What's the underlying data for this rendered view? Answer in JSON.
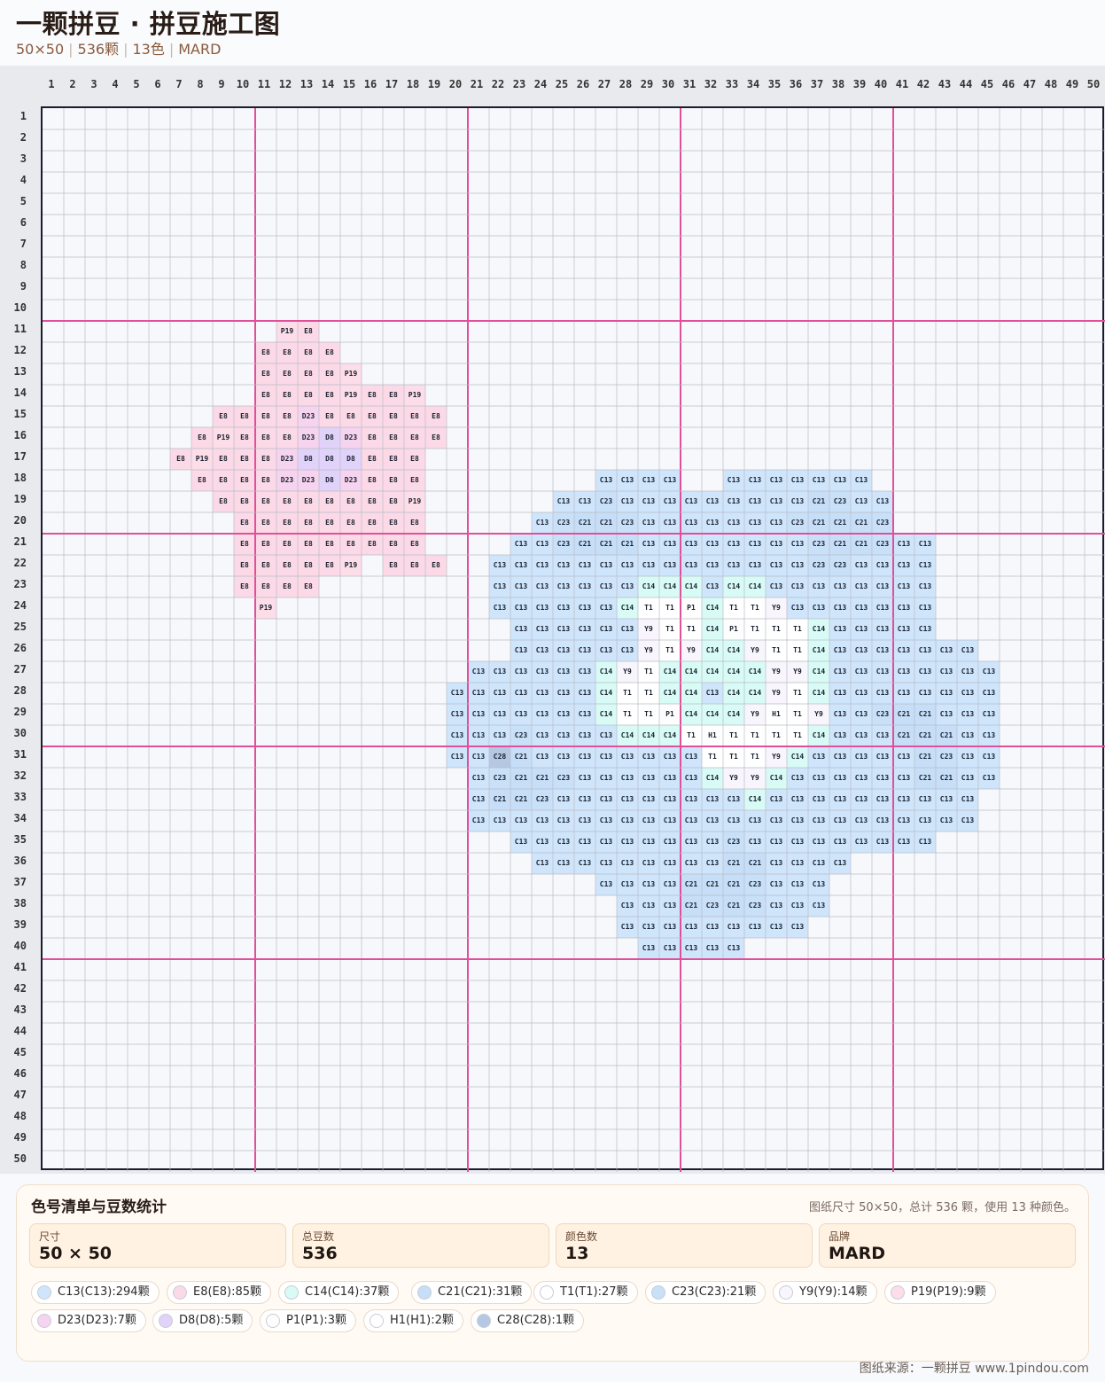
{
  "header": {
    "title": "一颗拼豆 · 拼豆施工图",
    "size": "50×50",
    "count": "536颗",
    "colors": "13色",
    "brand": "MARD"
  },
  "grid": {
    "cols": 50,
    "rows": 50,
    "major_every": 10,
    "palette": {
      "C13": "#cfe5fb",
      "C14": "#d8fbf6",
      "C21": "#c6def7",
      "C23": "#c9e0f9",
      "C28": "#b5c8e3",
      "E8": "#fcd9e6",
      "P19": "#fcdde8",
      "D23": "#f6d3ef",
      "D8": "#e0d2f9",
      "T1": "#ffffff",
      "Y9": "#f8f5fc",
      "P1": "#fdfdfd",
      "H1": "#ffffff"
    },
    "rows_data": [
      {
        "row": 11,
        "start": 12,
        "codes": [
          "P19",
          "E8"
        ]
      },
      {
        "row": 12,
        "start": 11,
        "codes": [
          "E8",
          "E8",
          "E8",
          "E8"
        ]
      },
      {
        "row": 13,
        "start": 11,
        "codes": [
          "E8",
          "E8",
          "E8",
          "E8",
          "P19"
        ]
      },
      {
        "row": 14,
        "start": 11,
        "codes": [
          "E8",
          "E8",
          "E8",
          "E8",
          "P19",
          "E8",
          "E8",
          "P19"
        ]
      },
      {
        "row": 15,
        "start": 9,
        "codes": [
          "E8",
          "E8",
          "E8",
          "E8",
          "D23",
          "E8",
          "E8",
          "E8",
          "E8",
          "E8",
          "E8"
        ]
      },
      {
        "row": 16,
        "start": 8,
        "codes": [
          "E8",
          "P19",
          "E8",
          "E8",
          "E8",
          "D23",
          "D8",
          "D23",
          "E8",
          "E8",
          "E8",
          "E8"
        ]
      },
      {
        "row": 17,
        "start": 7,
        "codes": [
          "E8",
          "P19",
          "E8",
          "E8",
          "E8",
          "D23",
          "D8",
          "D8",
          "D8",
          "E8",
          "E8",
          "E8"
        ]
      },
      {
        "row": 18,
        "start": 8,
        "codes": [
          "E8",
          "E8",
          "E8",
          "E8",
          "D23",
          "D23",
          "D8",
          "D23",
          "E8",
          "E8",
          "E8"
        ]
      },
      {
        "row": 18,
        "start": 27,
        "codes": [
          "C13",
          "C13",
          "C13",
          "C13"
        ]
      },
      {
        "row": 18,
        "start": 33,
        "codes": [
          "C13",
          "C13",
          "C13",
          "C13",
          "C13",
          "C13",
          "C13"
        ]
      },
      {
        "row": 19,
        "start": 9,
        "codes": [
          "E8",
          "E8",
          "E8",
          "E8",
          "E8",
          "E8",
          "E8",
          "E8",
          "E8",
          "P19"
        ]
      },
      {
        "row": 19,
        "start": 25,
        "codes": [
          "C13",
          "C13",
          "C23",
          "C13",
          "C13",
          "C13",
          "C13",
          "C13",
          "C13",
          "C13",
          "C13",
          "C13",
          "C21",
          "C23",
          "C13",
          "C13"
        ]
      },
      {
        "row": 20,
        "start": 10,
        "codes": [
          "E8",
          "E8",
          "E8",
          "E8",
          "E8",
          "E8",
          "E8",
          "E8",
          "E8"
        ]
      },
      {
        "row": 20,
        "start": 24,
        "codes": [
          "C13",
          "C23",
          "C21",
          "C21",
          "C23",
          "C13",
          "C13",
          "C13",
          "C13",
          "C13",
          "C13",
          "C13",
          "C23",
          "C21",
          "C21",
          "C21",
          "C23"
        ]
      },
      {
        "row": 21,
        "start": 10,
        "codes": [
          "E8",
          "E8",
          "E8",
          "E8",
          "E8",
          "E8",
          "E8",
          "E8",
          "E8"
        ]
      },
      {
        "row": 21,
        "start": 23,
        "codes": [
          "C13",
          "C13",
          "C23",
          "C21",
          "C21",
          "C21",
          "C13",
          "C13",
          "C13",
          "C13",
          "C13",
          "C13",
          "C13",
          "C13",
          "C23",
          "C21",
          "C21",
          "C23",
          "C13",
          "C13"
        ]
      },
      {
        "row": 22,
        "start": 10,
        "codes": [
          "E8",
          "E8",
          "E8",
          "E8",
          "E8",
          "P19"
        ]
      },
      {
        "row": 22,
        "start": 17,
        "codes": [
          "E8",
          "E8",
          "E8"
        ]
      },
      {
        "row": 22,
        "start": 22,
        "codes": [
          "C13",
          "C13",
          "C13",
          "C13",
          "C13",
          "C13",
          "C13",
          "C13",
          "C13",
          "C13",
          "C13",
          "C13",
          "C13",
          "C13",
          "C13",
          "C23",
          "C23",
          "C13",
          "C13",
          "C13",
          "C13"
        ]
      },
      {
        "row": 23,
        "start": 10,
        "codes": [
          "E8",
          "E8",
          "E8",
          "E8"
        ]
      },
      {
        "row": 23,
        "start": 22,
        "codes": [
          "C13",
          "C13",
          "C13",
          "C13",
          "C13",
          "C13",
          "C13",
          "C14",
          "C14",
          "C14",
          "C13",
          "C14",
          "C14",
          "C13",
          "C13",
          "C13",
          "C13",
          "C13",
          "C13",
          "C13",
          "C13"
        ]
      },
      {
        "row": 24,
        "start": 11,
        "codes": [
          "P19"
        ]
      },
      {
        "row": 24,
        "start": 22,
        "codes": [
          "C13",
          "C13",
          "C13",
          "C13",
          "C13",
          "C13",
          "C14",
          "T1",
          "T1",
          "P1",
          "C14",
          "T1",
          "T1",
          "Y9",
          "C13",
          "C13",
          "C13",
          "C13",
          "C13",
          "C13",
          "C13"
        ]
      },
      {
        "row": 25,
        "start": 23,
        "codes": [
          "C13",
          "C13",
          "C13",
          "C13",
          "C13",
          "C13",
          "Y9",
          "T1",
          "T1",
          "C14",
          "P1",
          "T1",
          "T1",
          "T1",
          "C14",
          "C13",
          "C13",
          "C13",
          "C13",
          "C13"
        ]
      },
      {
        "row": 26,
        "start": 23,
        "codes": [
          "C13",
          "C13",
          "C13",
          "C13",
          "C13",
          "C13",
          "Y9",
          "T1",
          "Y9",
          "C14",
          "C14",
          "Y9",
          "T1",
          "T1",
          "C14",
          "C13",
          "C13",
          "C13",
          "C13",
          "C13",
          "C13",
          "C13"
        ]
      },
      {
        "row": 27,
        "start": 21,
        "codes": [
          "C13",
          "C13",
          "C13",
          "C13",
          "C13",
          "C13",
          "C14",
          "Y9",
          "T1",
          "C14",
          "C14",
          "C14",
          "C14",
          "C14",
          "Y9",
          "Y9",
          "C14",
          "C13",
          "C13",
          "C13",
          "C13",
          "C13",
          "C13",
          "C13",
          "C13"
        ]
      },
      {
        "row": 28,
        "start": 20,
        "codes": [
          "C13",
          "C13",
          "C13",
          "C13",
          "C13",
          "C13",
          "C13",
          "C14",
          "T1",
          "T1",
          "C14",
          "C14",
          "C13",
          "C14",
          "C14",
          "Y9",
          "T1",
          "C14",
          "C13",
          "C13",
          "C13",
          "C13",
          "C13",
          "C13",
          "C13",
          "C13"
        ]
      },
      {
        "row": 29,
        "start": 20,
        "codes": [
          "C13",
          "C13",
          "C13",
          "C13",
          "C13",
          "C13",
          "C13",
          "C14",
          "T1",
          "T1",
          "P1",
          "C14",
          "C14",
          "C14",
          "Y9",
          "H1",
          "T1",
          "Y9",
          "C13",
          "C13",
          "C23",
          "C21",
          "C21",
          "C13",
          "C13",
          "C13"
        ]
      },
      {
        "row": 30,
        "start": 20,
        "codes": [
          "C13",
          "C13",
          "C13",
          "C23",
          "C13",
          "C13",
          "C13",
          "C13",
          "C14",
          "C14",
          "C14",
          "T1",
          "H1",
          "T1",
          "T1",
          "T1",
          "T1",
          "C14",
          "C13",
          "C13",
          "C13",
          "C21",
          "C21",
          "C21",
          "C13",
          "C13"
        ]
      },
      {
        "row": 31,
        "start": 20,
        "codes": [
          "C13",
          "C13",
          "C28",
          "C21",
          "C13",
          "C13",
          "C13",
          "C13",
          "C13",
          "C13",
          "C13",
          "C13",
          "T1",
          "T1",
          "T1",
          "Y9",
          "C14",
          "C13",
          "C13",
          "C13",
          "C13",
          "C13",
          "C21",
          "C23",
          "C13",
          "C13"
        ]
      },
      {
        "row": 32,
        "start": 21,
        "codes": [
          "C13",
          "C23",
          "C21",
          "C21",
          "C23",
          "C13",
          "C13",
          "C13",
          "C13",
          "C13",
          "C13",
          "C14",
          "Y9",
          "Y9",
          "C14",
          "C13",
          "C13",
          "C13",
          "C13",
          "C13",
          "C13",
          "C21",
          "C21",
          "C13",
          "C13"
        ]
      },
      {
        "row": 33,
        "start": 21,
        "codes": [
          "C13",
          "C21",
          "C21",
          "C23",
          "C13",
          "C13",
          "C13",
          "C13",
          "C13",
          "C13",
          "C13",
          "C13",
          "C13",
          "C14",
          "C13",
          "C13",
          "C13",
          "C13",
          "C13",
          "C13",
          "C13",
          "C13",
          "C13",
          "C13"
        ]
      },
      {
        "row": 34,
        "start": 21,
        "codes": [
          "C13",
          "C13",
          "C13",
          "C13",
          "C13",
          "C13",
          "C13",
          "C13",
          "C13",
          "C13",
          "C13",
          "C13",
          "C13",
          "C13",
          "C13",
          "C13",
          "C13",
          "C13",
          "C13",
          "C13",
          "C13",
          "C13",
          "C13",
          "C13"
        ]
      },
      {
        "row": 35,
        "start": 23,
        "codes": [
          "C13",
          "C13",
          "C13",
          "C13",
          "C13",
          "C13",
          "C13",
          "C13",
          "C13",
          "C13",
          "C23",
          "C13",
          "C13",
          "C13",
          "C13",
          "C13",
          "C13",
          "C13",
          "C13",
          "C13"
        ]
      },
      {
        "row": 36,
        "start": 24,
        "codes": [
          "C13",
          "C13",
          "C13",
          "C13",
          "C13",
          "C13",
          "C13",
          "C13",
          "C13",
          "C21",
          "C21",
          "C13",
          "C13",
          "C13",
          "C13"
        ]
      },
      {
        "row": 37,
        "start": 27,
        "codes": [
          "C13",
          "C13",
          "C13",
          "C13",
          "C21",
          "C21",
          "C21",
          "C23",
          "C13",
          "C13",
          "C13"
        ]
      },
      {
        "row": 38,
        "start": 28,
        "codes": [
          "C13",
          "C13",
          "C13",
          "C21",
          "C23",
          "C21",
          "C23",
          "C13",
          "C13",
          "C13"
        ]
      },
      {
        "row": 39,
        "start": 28,
        "codes": [
          "C13",
          "C13",
          "C13",
          "C13",
          "C13",
          "C13",
          "C13",
          "C13",
          "C13"
        ]
      },
      {
        "row": 40,
        "start": 29,
        "codes": [
          "C13",
          "C13",
          "C13",
          "C13",
          "C13"
        ]
      }
    ]
  },
  "panel": {
    "title": "色号清单与豆数统计",
    "description": "图纸尺寸 50×50，总计 536 颗，使用 13 种颜色。",
    "stats": [
      {
        "label": "尺寸",
        "value": "50 × 50"
      },
      {
        "label": "总豆数",
        "value": "536"
      },
      {
        "label": "颜色数",
        "value": "13"
      },
      {
        "label": "品牌",
        "value": "MARD"
      }
    ],
    "chips": [
      {
        "text": "C13(C13):294颗",
        "color": "#cfe5fb"
      },
      {
        "text": "E8(E8):85颗",
        "color": "#fcd9e6"
      },
      {
        "text": "C14(C14):37颗",
        "color": "#d8fbf6"
      },
      {
        "text": "C21(C21):31颗",
        "color": "#c6def7"
      },
      {
        "text": "T1(T1):27颗",
        "color": "#ffffff"
      },
      {
        "text": "C23(C23):21颗",
        "color": "#c9e0f9"
      },
      {
        "text": "Y9(Y9):14颗",
        "color": "#f8f5fc"
      },
      {
        "text": "P19(P19):9颗",
        "color": "#fcdde8"
      },
      {
        "text": "D23(D23):7颗",
        "color": "#f6d3ef"
      },
      {
        "text": "D8(D8):5颗",
        "color": "#e0d2f9"
      },
      {
        "text": "P1(P1):3颗",
        "color": "#fdfdfd"
      },
      {
        "text": "H1(H1):2颗",
        "color": "#ffffff"
      },
      {
        "text": "C28(C28):1颗",
        "color": "#b5c8e3"
      }
    ]
  },
  "footer": {
    "source": "图纸来源：一颗拼豆 www.1pindou.com"
  }
}
